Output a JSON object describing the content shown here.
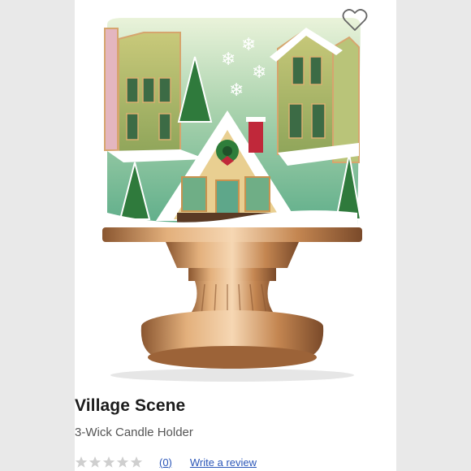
{
  "product": {
    "name": "Village Scene",
    "subtitle": "3-Wick Candle Holder",
    "image_alt_icon": "candle-holder-image"
  },
  "rating": {
    "stars_filled": 0,
    "stars_total": 5,
    "review_count": "(0)",
    "write_review_label": "Write a review"
  },
  "icons": {
    "favorite": "heart-outline-icon",
    "star": "star-icon"
  },
  "colors": {
    "link": "#2b56b8",
    "star_empty": "#cfcfcf",
    "glass_green": "#8fc29f",
    "gold": "#c88d52"
  }
}
